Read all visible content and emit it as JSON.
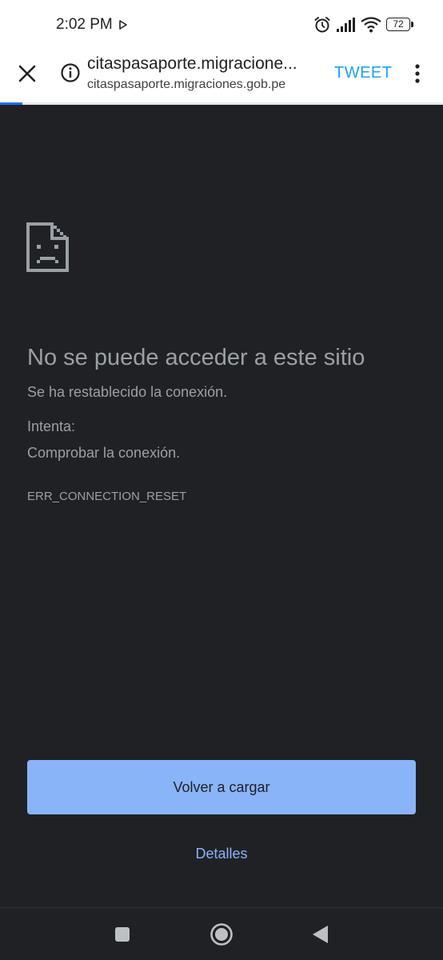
{
  "status_bar": {
    "time": "2:02 PM",
    "battery_level": "72",
    "icons": [
      "play-icon",
      "alarm-icon",
      "signal-icon",
      "wifi-icon",
      "battery-icon"
    ]
  },
  "toolbar": {
    "close_icon": "close-icon",
    "info_icon": "info-icon",
    "url_title": "citaspasaporte.migracione...",
    "url_domain": "citaspasaporte.migraciones.gob.pe",
    "tweet_label": "TWEET",
    "more_icon": "more-vert-icon",
    "load_progress": 0.05
  },
  "error_page": {
    "icon": "sad-file-icon",
    "title": "No se puede acceder a este sitio",
    "description": "Se ha restablecido la conexión.",
    "try_label": "Intenta:",
    "suggestion": "Comprobar la conexión.",
    "error_code": "ERR_CONNECTION_RESET",
    "reload_label": "Volver a cargar",
    "details_label": "Detalles"
  },
  "nav_bar": {
    "icons": [
      "recents-icon",
      "home-icon",
      "back-icon"
    ]
  },
  "colors": {
    "page_background": "#202124",
    "toolbar_background": "#ffffff",
    "text_secondary": "#9aa0a6",
    "accent_blue": "#8ab4f8",
    "tweet_blue": "#1da1f2"
  }
}
